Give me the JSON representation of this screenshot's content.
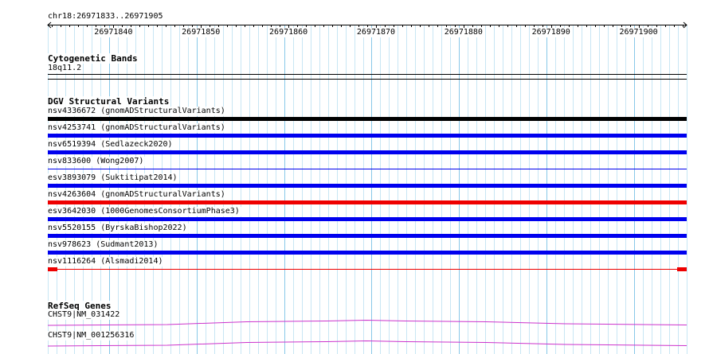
{
  "ruler": {
    "location": "chr18:26971833..26971905",
    "start": 26971833,
    "end": 26971905,
    "ticks": [
      "26971840",
      "26971850",
      "26971860",
      "26971870",
      "26971880",
      "26971890",
      "26971900"
    ]
  },
  "cytoband_track": {
    "title": "Cytogenetic Bands",
    "band": "18q11.2"
  },
  "dgv_track": {
    "title": "DGV Structural Variants",
    "variants": [
      {
        "label": "nsv4336672 (gnomADStructuralVariants)",
        "color": "#000000",
        "style": "solid"
      },
      {
        "label": "nsv4253741 (gnomADStructuralVariants)",
        "color": "#0000ee",
        "style": "solid"
      },
      {
        "label": "nsv6519394 (Sedlazeck2020)",
        "color": "#0000ee",
        "style": "solid"
      },
      {
        "label": "nsv833600 (Wong2007)",
        "color": "#0000ee",
        "style": "thin"
      },
      {
        "label": "esv3893079 (Suktitipat2014)",
        "color": "#0000ee",
        "style": "solid"
      },
      {
        "label": "nsv4263604 (gnomADStructuralVariants)",
        "color": "#ee0000",
        "style": "solid"
      },
      {
        "label": "esv3642030 (1000GenomesConsortiumPhase3)",
        "color": "#0000ee",
        "style": "solid"
      },
      {
        "label": "nsv5520155 (ByrskaBishop2022)",
        "color": "#0000ee",
        "style": "solid"
      },
      {
        "label": "nsv978623 (Sudmant2013)",
        "color": "#0000ee",
        "style": "solid"
      },
      {
        "label": "nsv1116264 (Alsmadi2014)",
        "color": "#ee0000",
        "style": "intron"
      }
    ]
  },
  "refseq_track": {
    "title": "RefSeq Genes",
    "genes": [
      {
        "label": "CHST9|NM_031422",
        "color": "#cc33cc"
      },
      {
        "label": "CHST9|NM_001256316",
        "color": "#cc33cc"
      }
    ]
  }
}
